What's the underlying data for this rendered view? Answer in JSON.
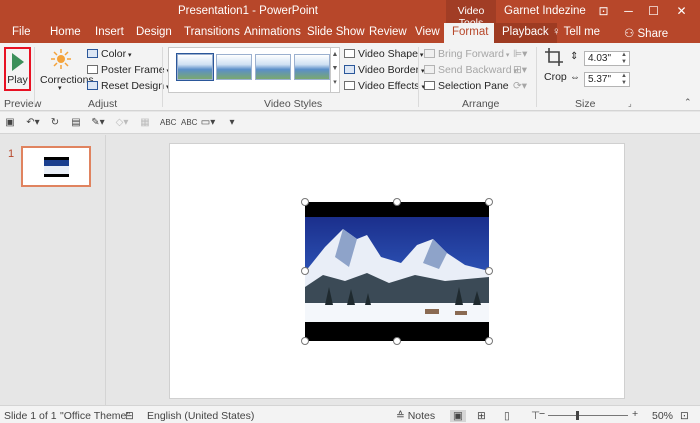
{
  "titlebar": {
    "title": "Presentation1  -  PowerPoint",
    "context_tools": "Video Tools",
    "user": "Garnet Indezine",
    "minimize": "─",
    "restore": "☐",
    "close": "✕",
    "ribbon_display": "⊡"
  },
  "tabs": {
    "file": "File",
    "home": "Home",
    "insert": "Insert",
    "design": "Design",
    "transitions": "Transitions",
    "animations": "Animations",
    "slideshow": "Slide Show",
    "review": "Review",
    "view": "View",
    "format": "Format",
    "playback": "Playback",
    "tellme": "Tell me",
    "share": "Share"
  },
  "ribbon": {
    "preview": {
      "play": "Play",
      "label": "Preview"
    },
    "adjust": {
      "corrections": "Corrections",
      "color": "Color",
      "poster_frame": "Poster Frame",
      "reset_design": "Reset Design",
      "label": "Adjust"
    },
    "video_styles": {
      "video_shape": "Video Shape",
      "video_border": "Video Border",
      "video_effects": "Video Effects",
      "label": "Video Styles"
    },
    "arrange": {
      "bring_forward": "Bring Forward",
      "send_backward": "Send Backward",
      "selection_pane": "Selection Pane",
      "label": "Arrange"
    },
    "size": {
      "crop": "Crop",
      "height": "4.03\"",
      "width": "5.37\"",
      "label": "Size"
    }
  },
  "slides": {
    "current_number": "1"
  },
  "status": {
    "slide_info": "Slide 1 of 1",
    "theme": "\"Office Theme\"",
    "language": "English (United States)",
    "notes": "Notes",
    "zoom": "50%",
    "zoom_out": "−",
    "zoom_in": "+"
  },
  "colors": {
    "accent": "#b7472a",
    "play_highlight": "#e81123",
    "play_icon": "#3c8f5a"
  }
}
